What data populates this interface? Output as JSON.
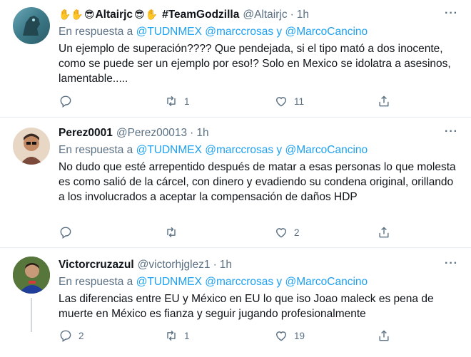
{
  "reply_prefix": "En respuesta a",
  "reply_joiner": "y",
  "tweets": [
    {
      "display_name": "#TeamGodzilla",
      "display_name_prefix": "Altairjc",
      "handle": "@Altairjc",
      "time": "1h",
      "mentions": [
        "@TUDNMEX",
        "@marccrosas",
        "@MarcoCancino"
      ],
      "text": "Un ejemplo de superación???? Que pendejada, si el tipo mató a dos inocente, como se puede ser un ejemplo por eso!? Solo en Mexico se idolatra a asesinos, lamentable.....",
      "replies": "",
      "retweets": "1",
      "likes": "11"
    },
    {
      "display_name": "Perez0001",
      "handle": "@Perez00013",
      "time": "1h",
      "mentions": [
        "@TUDNMEX",
        "@marccrosas",
        "@MarcoCancino"
      ],
      "text": "No dudo que esté arrepentido después de matar a esas personas lo que molesta es como salió de la cárcel, con dinero y evadiendo su condena original, orillando a los involucrados a aceptar la compensación de daños HDP",
      "replies": "",
      "retweets": "",
      "likes": "2"
    },
    {
      "display_name": "Victorcruzazul",
      "handle": "@victorhjglez1",
      "time": "1h",
      "mentions": [
        "@TUDNMEX",
        "@marccrosas",
        "@MarcoCancino"
      ],
      "text": "Las diferencias entre EU y México en EU lo que iso Joao maleck es pena de muerte en México es fianza y seguir jugando profesionalmente",
      "replies": "2",
      "retweets": "1",
      "likes": "19"
    }
  ]
}
